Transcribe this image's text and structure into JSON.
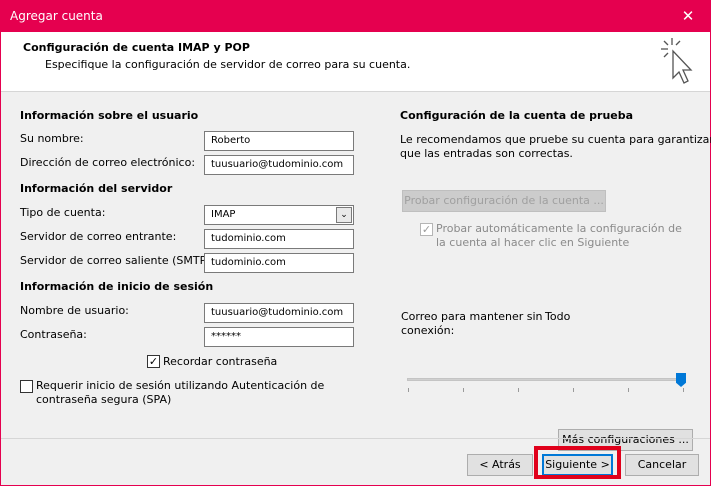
{
  "window": {
    "title": "Agregar cuenta",
    "close_glyph": "✕"
  },
  "header": {
    "title": "Configuración de cuenta IMAP y POP",
    "subtitle": "Especifique la configuración de servidor de correo para su cuenta.",
    "icon": "cursor-click-icon"
  },
  "user_info": {
    "heading": "Información sobre el usuario",
    "name_label": "Su nombre:",
    "name_value": "Roberto",
    "email_label": "Dirección de correo electrónico:",
    "email_value": "tuusuario@tudominio.com"
  },
  "server_info": {
    "heading": "Información del servidor",
    "account_type_label": "Tipo de cuenta:",
    "account_type_value": "IMAP",
    "incoming_label": "Servidor de correo entrante:",
    "incoming_value": "tudominio.com",
    "outgoing_label": "Servidor de correo saliente (SMTP):",
    "outgoing_value": "tudominio.com"
  },
  "login_info": {
    "heading": "Información de inicio de sesión",
    "username_label": "Nombre de usuario:",
    "username_value": "tuusuario@tudominio.com",
    "password_label": "Contraseña:",
    "password_value": "******",
    "remember_label": "Recordar contraseña",
    "remember_checked": true,
    "spa_label_line1": "Requerir inicio de sesión utilizando Autenticación de",
    "spa_label_line2": "contraseña segura (SPA)",
    "spa_checked": false
  },
  "test_settings": {
    "heading": "Configuración de la cuenta de prueba",
    "desc_line1": "Le recomendamos que pruebe su cuenta para garantizar",
    "desc_line2": "que las entradas son correctas.",
    "test_button": "Probar configuración de la cuenta ...",
    "auto_test_line1": "Probar automáticamente la configuración de",
    "auto_test_line2": "la cuenta al hacer clic en Siguiente",
    "auto_test_checked": true
  },
  "offline": {
    "label_line1": "Correo para mantener sin",
    "label_line2": "conexión:",
    "value": "Todo",
    "slider_fraction": 1.0
  },
  "more_settings_button": "Más configuraciones ...",
  "footer": {
    "back": "< Atrás",
    "next": "Siguiente >",
    "cancel": "Cancelar"
  },
  "colors": {
    "accent": "#e5004f",
    "highlight": "#e0001b",
    "slider": "#0078d7"
  }
}
